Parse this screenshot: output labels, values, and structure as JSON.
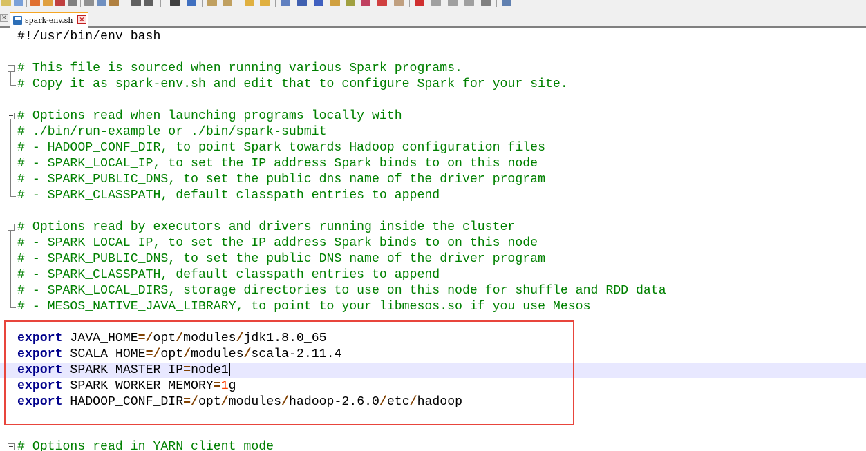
{
  "tab": {
    "label": "spark-env.sh",
    "close": "×"
  },
  "editor": {
    "lines": [
      "#!/usr/bin/env bash",
      "",
      "# This file is sourced when running various Spark programs.",
      "# Copy it as spark-env.sh and edit that to configure Spark for your site.",
      "",
      "# Options read when launching programs locally with",
      "# ./bin/run-example or ./bin/spark-submit",
      "# - HADOOP_CONF_DIR, to point Spark towards Hadoop configuration files",
      "# - SPARK_LOCAL_IP, to set the IP address Spark binds to on this node",
      "# - SPARK_PUBLIC_DNS, to set the public dns name of the driver program",
      "# - SPARK_CLASSPATH, default classpath entries to append",
      "",
      "# Options read by executors and drivers running inside the cluster",
      "# - SPARK_LOCAL_IP, to set the IP address Spark binds to on this node",
      "# - SPARK_PUBLIC_DNS, to set the public DNS name of the driver program",
      "# - SPARK_CLASSPATH, default classpath entries to append",
      "# - SPARK_LOCAL_DIRS, storage directories to use on this node for shuffle and RDD data",
      "# - MESOS_NATIVE_JAVA_LIBRARY, to point to your libmesos.so if you use Mesos",
      "",
      "",
      "",
      "",
      "",
      "",
      "",
      "",
      "# Options read in YARN client mode"
    ],
    "exports": [
      {
        "keyword": "export",
        "name": "JAVA_HOME",
        "sep": "=",
        "value": "/opt/modules/jdk1.8.0_65"
      },
      {
        "keyword": "export",
        "name": "SCALA_HOME",
        "sep": "=",
        "value": "/opt/modules/scala-2.11.4"
      },
      {
        "keyword": "export",
        "name": "SPARK_MASTER_IP",
        "sep": "=",
        "value": "node1"
      },
      {
        "keyword": "export",
        "name": "SPARK_WORKER_MEMORY",
        "sep": "=",
        "value_num": "1",
        "value_rest": "g"
      },
      {
        "keyword": "export",
        "name": "HADOOP_CONF_DIR",
        "sep": "=",
        "value": "/opt/modules/hadoop-2.6.0/etc/hadoop"
      }
    ]
  },
  "colors": {
    "comment": "#008000",
    "keyword": "#00008b",
    "operator": "#804000",
    "number": "#ff4000",
    "current_line": "#e8e8ff",
    "highlight_box": "#e8453c"
  }
}
